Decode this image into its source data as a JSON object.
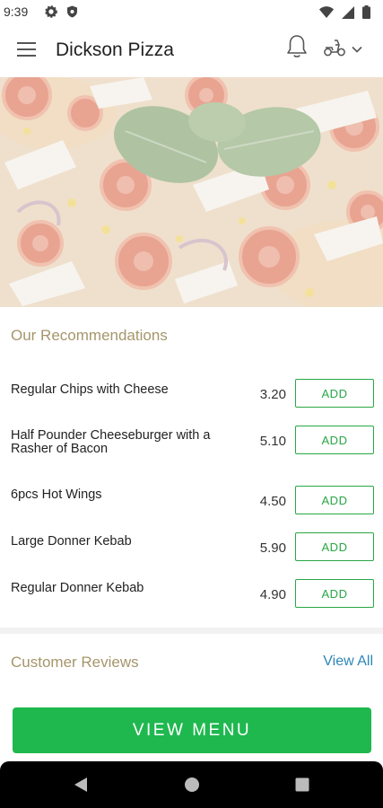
{
  "status_bar": {
    "time": "9:39",
    "icons": [
      "gear-icon",
      "shield-icon",
      "wifi-icon",
      "signal-icon",
      "battery-icon"
    ]
  },
  "app_bar": {
    "title": "Dickson Pizza",
    "icons": [
      "hamburger-menu-icon",
      "bell-icon",
      "scooter-icon",
      "chevron-down-icon"
    ]
  },
  "hero": {
    "alt": "pizza with basil, tomatoes and cheese"
  },
  "recommendations": {
    "title": "Our Recommendations",
    "add_label": "ADD",
    "items": [
      {
        "name": "Regular Chips with Cheese",
        "price": "3.20"
      },
      {
        "name": "Half Pounder Cheeseburger with a Rasher of Bacon",
        "price": "5.10"
      },
      {
        "name": "6pcs Hot Wings",
        "price": "4.50"
      },
      {
        "name": "Large Donner Kebab",
        "price": "5.90"
      },
      {
        "name": "Regular Donner Kebab",
        "price": "4.90"
      }
    ]
  },
  "reviews": {
    "title": "Customer Reviews",
    "view_all": "View All"
  },
  "cta": {
    "label": "VIEW MENU"
  },
  "nav_bar": {
    "icons": [
      "back-icon",
      "home-icon",
      "recents-icon"
    ]
  },
  "colors": {
    "accent_green": "#1fb84f",
    "add_green": "#28a745",
    "section_gold": "#a5966a",
    "link_blue": "#2d86b7"
  }
}
